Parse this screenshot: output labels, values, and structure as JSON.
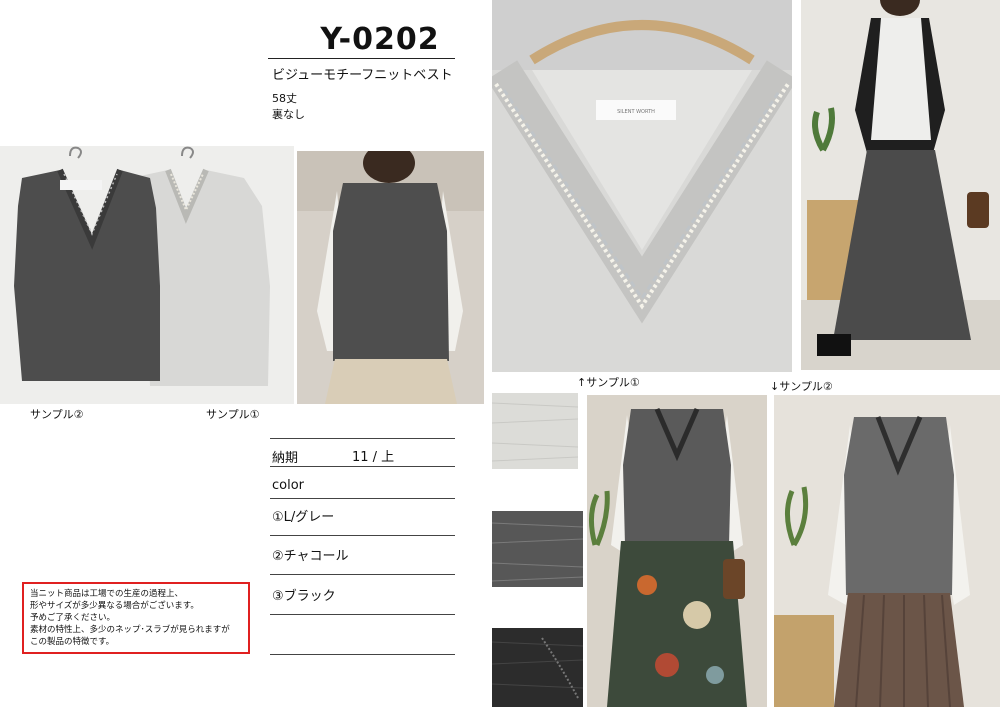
{
  "product": {
    "code": "Y-0202",
    "name": "ビジューモチーフニットベスト",
    "length": "58丈",
    "lining": "裏なし"
  },
  "captions": {
    "sample2_left": "サンプル②",
    "sample1_left": "サンプル①",
    "sample1_up": "↑サンプル①",
    "sample2_down": "↓サンプル②"
  },
  "specs": {
    "delivery_label": "納期",
    "delivery_value": "11 / 上",
    "color_label": "color",
    "colors": [
      "①L/グレー",
      "②チャコール",
      "③ブラック"
    ]
  },
  "notice": [
    "当ニット商品は工場での生産の過程上、",
    "形やサイズが多少異なる場合がございます。",
    "予めご了承ください。",
    "素材の特性上、多少のネップ･スラブが見られますが",
    "この製品の特徴です。"
  ],
  "colors": {
    "notice_border": "#e02020",
    "charcoal": "#4a4a4a",
    "light_gray": "#d9d9d9",
    "black": "#2a2a2a"
  },
  "tag_text": "SILENT WORTH"
}
